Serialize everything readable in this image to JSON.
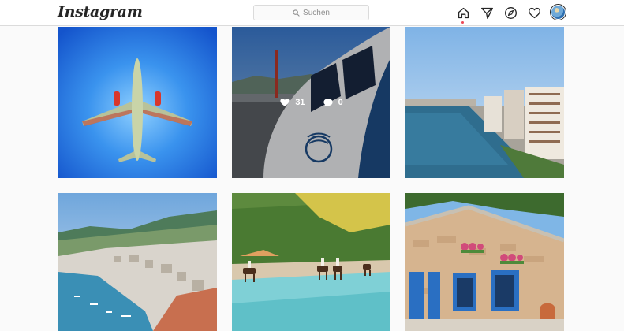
{
  "app": {
    "logo_text": "Instagram"
  },
  "header": {
    "search": {
      "placeholder": "Suchen",
      "icon": "search-icon"
    },
    "nav": [
      {
        "name": "home",
        "icon": "home-icon",
        "active": true
      },
      {
        "name": "direct",
        "icon": "paper-plane-icon"
      },
      {
        "name": "explore",
        "icon": "compass-icon"
      },
      {
        "name": "activity",
        "icon": "heart-icon"
      },
      {
        "name": "profile",
        "icon": "avatar"
      }
    ]
  },
  "grid": {
    "posts": [
      {
        "subject": "airplane from below against blue sky"
      },
      {
        "subject": "aircraft cockpit nose with airline logo",
        "hover": true,
        "likes": "31",
        "comments": "0"
      },
      {
        "subject": "seaside promenade with apartment buildings"
      },
      {
        "subject": "coastal town on hillside with harbor"
      },
      {
        "subject": "horse riders on beach with trees"
      },
      {
        "subject": "stone house with blue doors and flowers"
      }
    ]
  },
  "colors": {
    "header_bg": "#ffffff",
    "page_bg": "#fafafa",
    "border": "#dbdbdb",
    "text": "#262626",
    "muted": "#8e8e8e",
    "notification": "#ed4956"
  }
}
